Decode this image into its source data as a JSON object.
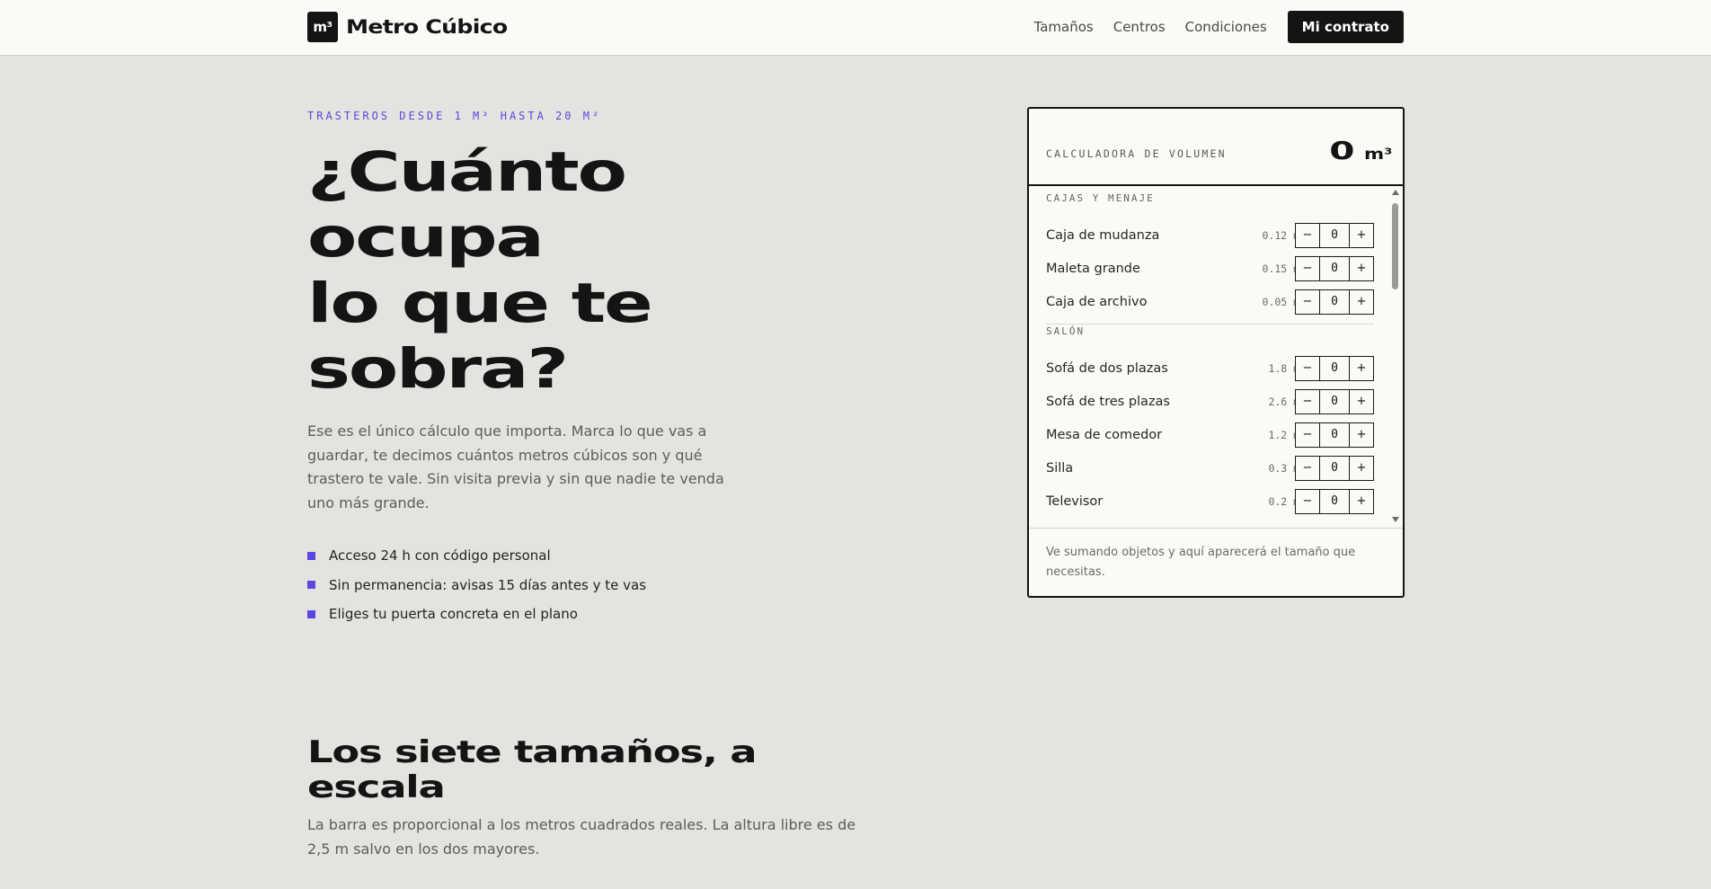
{
  "header": {
    "logo_mark": "m³",
    "logo_text": "Metro Cúbico",
    "nav": [
      "Tamaños",
      "Centros",
      "Condiciones"
    ],
    "cta": "Mi contrato"
  },
  "hero": {
    "eyebrow": "TRASTEROS DESDE 1 M² HASTA 20 M²",
    "title_lines": [
      "¿Cuánto",
      "ocupa",
      "lo que te",
      "sobra?"
    ],
    "lead": "Ese es el único cálculo que importa. Marca lo que vas a guardar, te decimos cuántos metros cúbicos son y qué trastero te vale. Sin visita previa y sin que nadie te venda uno más grande.",
    "features": [
      "Acceso 24 h con código personal",
      "Sin permanencia: avisas 15 días antes y te vas",
      "Eliges tu puerta concreta en el plano"
    ]
  },
  "calculator": {
    "label": "CALCULADORA DE VOLUMEN",
    "total_value": "0",
    "total_unit": "m³",
    "minus": "−",
    "plus": "+",
    "groups": [
      {
        "title": "CAJAS Y MENAJE",
        "items": [
          {
            "name": "Caja de mudanza",
            "volume": "0.12 m³",
            "qty": "0"
          },
          {
            "name": "Maleta grande",
            "volume": "0.15 m³",
            "qty": "0"
          },
          {
            "name": "Caja de archivo",
            "volume": "0.05 m³",
            "qty": "0"
          }
        ]
      },
      {
        "title": "SALÓN",
        "items": [
          {
            "name": "Sofá de dos plazas",
            "volume": "1.8 m³",
            "qty": "0"
          },
          {
            "name": "Sofá de tres plazas",
            "volume": "2.6 m³",
            "qty": "0"
          },
          {
            "name": "Mesa de comedor",
            "volume": "1.2 m³",
            "qty": "0"
          },
          {
            "name": "Silla",
            "volume": "0.3 m³",
            "qty": "0"
          },
          {
            "name": "Televisor",
            "volume": "0.2 m³",
            "qty": "0"
          }
        ]
      }
    ],
    "footer_hint": "Ve sumando objetos y aquí aparecerá el tamaño que necesitas."
  },
  "sizes_section": {
    "title_lines": [
      "Los siete tamaños, a",
      "escala"
    ],
    "subtitle": "La barra es proporcional a los metros cuadrados reales. La altura libre es de 2,5 m salvo en los dos mayores."
  },
  "colors": {
    "accent": "#5a46e0",
    "ink": "#141414",
    "page_bg": "#e4e3df",
    "panel_bg": "#fafaf7"
  }
}
